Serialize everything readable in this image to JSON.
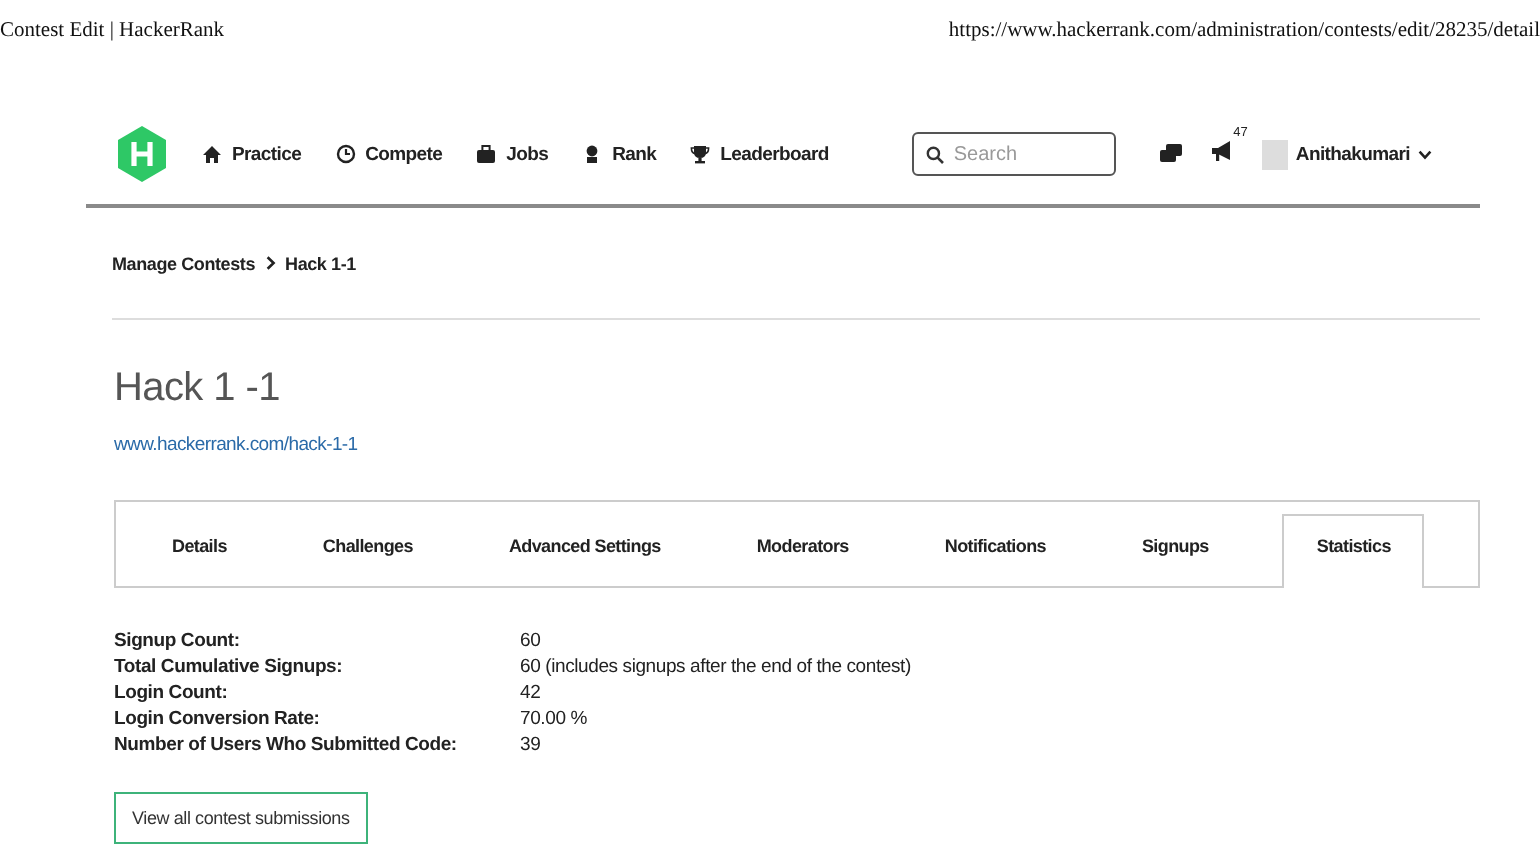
{
  "print_header": {
    "title": "Contest Edit | HackerRank",
    "url": "https://www.hackerrank.com/administration/contests/edit/28235/detail"
  },
  "nav": {
    "items": [
      {
        "label": "Practice",
        "kind": "home"
      },
      {
        "label": "Compete",
        "kind": "clock"
      },
      {
        "label": "Jobs",
        "kind": "briefcase"
      },
      {
        "label": "Rank",
        "kind": "medal"
      },
      {
        "label": "Leaderboard",
        "kind": "trophy"
      }
    ],
    "search": {
      "placeholder": "Search"
    },
    "notification_count": "47",
    "user": "Anithakumari"
  },
  "breadcrumb": [
    "Manage Contests",
    "Hack 1-1"
  ],
  "contest": {
    "title": "Hack 1 -1",
    "link": "www.hackerrank.com/hack-1-1"
  },
  "tabs": [
    {
      "label": "Details",
      "selected": false
    },
    {
      "label": "Challenges",
      "selected": false
    },
    {
      "label": "Advanced Settings",
      "selected": false
    },
    {
      "label": "Moderators",
      "selected": false
    },
    {
      "label": "Notifications",
      "selected": false
    },
    {
      "label": "Signups",
      "selected": false
    },
    {
      "label": "Statistics",
      "selected": true
    }
  ],
  "statistics": [
    {
      "label": "Signup Count:",
      "value": "60"
    },
    {
      "label": "Total Cumulative Signups:",
      "value": "60 (includes signups after the end of the contest)"
    },
    {
      "label": "Login Count:",
      "value": "42"
    },
    {
      "label": "Login Conversion Rate:",
      "value": "70.00 %"
    },
    {
      "label": "Number of Users Who Submitted Code:",
      "value": "39"
    }
  ],
  "buttons": [
    "View all contest submissions"
  ]
}
